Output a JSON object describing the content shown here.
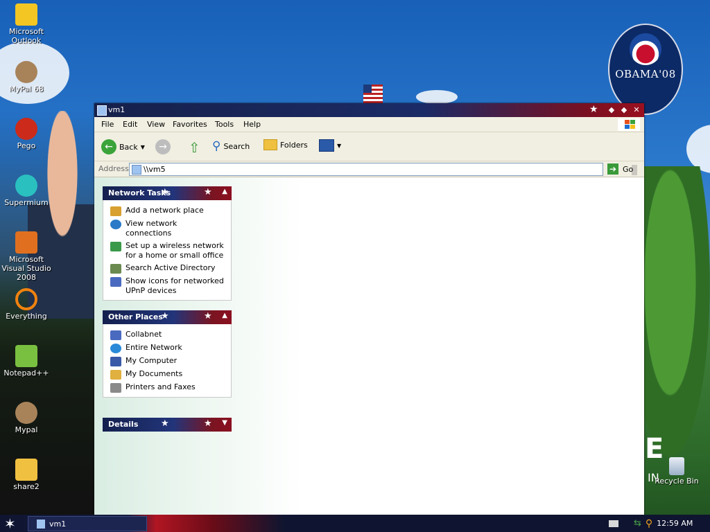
{
  "desktop": {
    "icons": [
      {
        "label": "Microsoft Outlook",
        "icon": "outlook-icon",
        "color": "#f3c623"
      },
      {
        "label": "MyPal 68",
        "icon": "mypal-icon",
        "color": "#a8835a"
      },
      {
        "label": "Pego",
        "icon": "pego-icon",
        "color": "#cc2a1a"
      },
      {
        "label": "Supermium",
        "icon": "supermium-icon",
        "color": "#2ac0c0"
      },
      {
        "label": "Microsoft Visual Studio 2008",
        "icon": "visual-studio-icon",
        "color": "#e07020"
      },
      {
        "label": "Everything",
        "icon": "everything-icon",
        "color": "#f0820f"
      },
      {
        "label": "Notepad++",
        "icon": "notepadpp-icon",
        "color": "#7ac040"
      },
      {
        "label": "Mypal",
        "icon": "mypal-icon",
        "color": "#a8835a"
      },
      {
        "label": "share2",
        "icon": "folder-icon",
        "color": "#f0c040"
      }
    ],
    "recycle_bin": "Recycle Bin",
    "seal_text": "OBAMA'08",
    "big_letter": "E",
    "in_text": "IN"
  },
  "window": {
    "title": "vm1",
    "menu": [
      "File",
      "Edit",
      "View",
      "Favorites",
      "Tools",
      "Help"
    ],
    "toolbar": {
      "back": "Back",
      "search": "Search",
      "folders": "Folders"
    },
    "address": {
      "label": "Address",
      "value": "\\\\vm5",
      "go": "Go"
    },
    "panels": [
      {
        "title": "Network Tasks",
        "items": [
          {
            "label": "Add a network place",
            "icon": "add-network-place-icon",
            "color": "#d8a030"
          },
          {
            "label": "View network connections",
            "icon": "network-connections-icon",
            "color": "#2a7ac8"
          },
          {
            "label": "Set up a wireless network for a home or small office",
            "icon": "wireless-network-icon",
            "color": "#3a9a4a"
          },
          {
            "label": "Search Active Directory",
            "icon": "active-directory-icon",
            "color": "#6a8a50"
          },
          {
            "label": "Show icons for networked UPnP devices",
            "icon": "upnp-devices-icon",
            "color": "#4a6ac0"
          }
        ]
      },
      {
        "title": "Other Places",
        "items": [
          {
            "label": "Collabnet",
            "icon": "network-icon",
            "color": "#4a6ac0"
          },
          {
            "label": "Entire Network",
            "icon": "entire-network-icon",
            "color": "#2a8ad8"
          },
          {
            "label": "My Computer",
            "icon": "my-computer-icon",
            "color": "#3a5aa8"
          },
          {
            "label": "My Documents",
            "icon": "my-documents-icon",
            "color": "#e0b040"
          },
          {
            "label": "Printers and Faxes",
            "icon": "printers-icon",
            "color": "#8a8a8a"
          }
        ]
      },
      {
        "title": "Details",
        "items": []
      }
    ]
  },
  "taskbar": {
    "task": "vm1",
    "clock": "12:59 AM"
  }
}
